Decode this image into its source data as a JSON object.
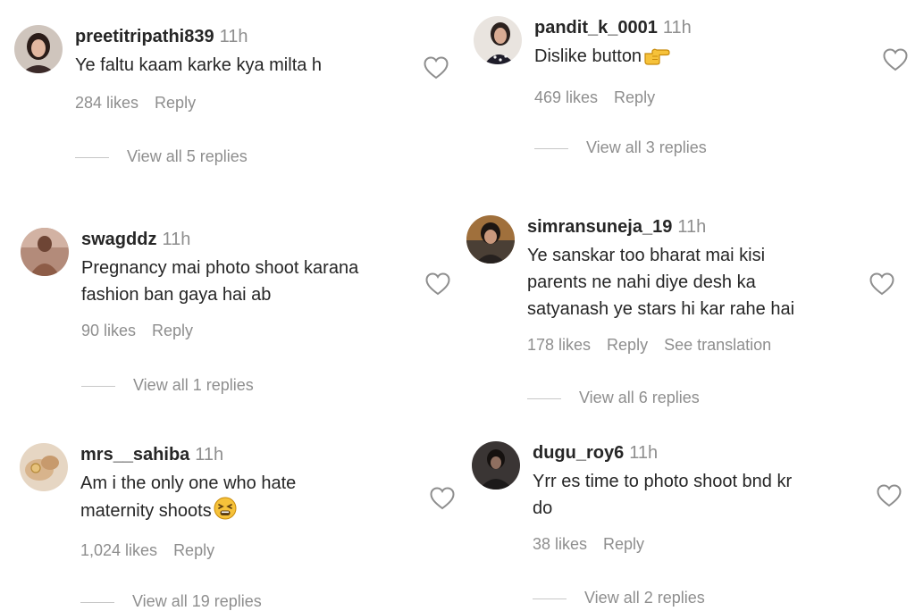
{
  "comments": [
    {
      "username": "preetitripathi839",
      "time": "11h",
      "lines": [
        "Ye faltu kaam karke kya milta h"
      ],
      "likes": "284 likes",
      "reply": "Reply",
      "view_replies": "View all 5 replies"
    },
    {
      "username": "pandit_k_0001",
      "time": "11h",
      "lines": [
        "Dislike button"
      ],
      "emoji": "pointing-hand-emoji",
      "likes": "469 likes",
      "reply": "Reply",
      "view_replies": "View all 3 replies"
    },
    {
      "username": "swagddz",
      "time": "11h",
      "lines": [
        "Pregnancy mai photo shoot karana",
        "fashion ban gaya hai ab"
      ],
      "likes": "90 likes",
      "reply": "Reply",
      "view_replies": "View all 1 replies"
    },
    {
      "username": "simransuneja_19",
      "time": "11h",
      "lines": [
        "Ye sanskar too bharat mai kisi",
        "parents ne nahi diye desh ka",
        "satyanash ye stars hi kar rahe hai"
      ],
      "likes": "178 likes",
      "reply": "Reply",
      "see_translation": "See translation",
      "view_replies": "View all 6 replies"
    },
    {
      "username": "mrs__sahiba",
      "time": "11h",
      "lines": [
        "Am i the only one who hate",
        "maternity shoots"
      ],
      "emoji": "tired-face-emoji",
      "likes": "1,024 likes",
      "reply": "Reply",
      "view_replies": "View all 19 replies"
    },
    {
      "username": "dugu_roy6",
      "time": "11h",
      "lines": [
        "Yrr es time to photo shoot bnd kr",
        "do"
      ],
      "likes": "38 likes",
      "reply": "Reply",
      "view_replies": "View all 2 replies"
    }
  ],
  "icons": {
    "like": "heart-outline-icon"
  },
  "colors": {
    "text": "#262626",
    "secondary": "#8e8e8e"
  }
}
